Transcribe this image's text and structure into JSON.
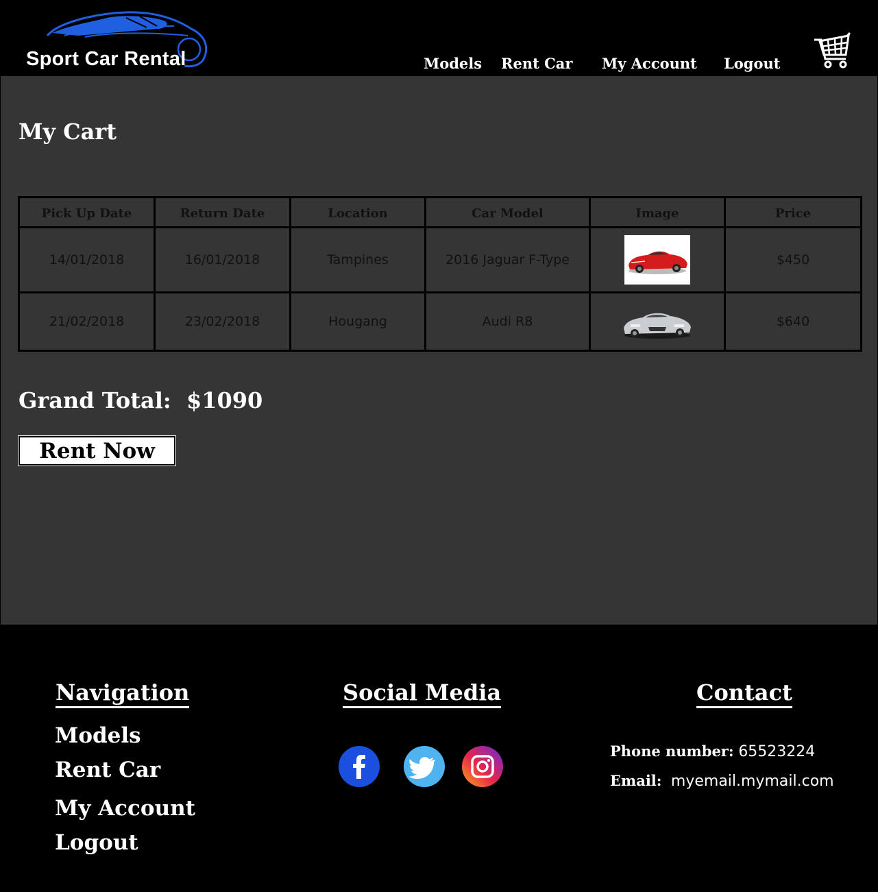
{
  "brand": {
    "name": "Sport Car Rental",
    "accent": "#1f5fe0"
  },
  "nav": [
    {
      "label": "Models"
    },
    {
      "label": "Rent Car"
    },
    {
      "label": "My Account"
    },
    {
      "label": "Logout"
    }
  ],
  "cart_icon": "shopping-cart-icon",
  "page_title": "My Cart",
  "table": {
    "headers": [
      "Pick Up Date",
      "Return Date",
      "Location",
      "Car Model",
      "Image",
      "Price"
    ],
    "rows": [
      {
        "pickup": "14/01/2018",
        "return": "16/01/2018",
        "location": "Tampines",
        "model": "2016 Jaguar F-Type",
        "image": "red-sports-car",
        "price": "$450"
      },
      {
        "pickup": "21/02/2018",
        "return": "23/02/2018",
        "location": "Hougang",
        "model": "Audi R8",
        "image": "silver-sports-car",
        "price": "$640"
      }
    ]
  },
  "grand_total": {
    "label": "Grand Total:",
    "value": "$1090"
  },
  "rent_button": "Rent Now",
  "footer": {
    "navigation": {
      "heading": "Navigation",
      "links": [
        "Models",
        "Rent Car",
        "My Account",
        "Logout"
      ]
    },
    "social": {
      "heading": "Social Media",
      "icons": [
        "facebook-icon",
        "twitter-icon",
        "instagram-icon"
      ]
    },
    "contact": {
      "heading": "Contact",
      "phone_label": "Phone number:",
      "phone": "65523224",
      "email_label": "Email:",
      "email": "myemail.mymail.com"
    }
  },
  "colors": {
    "header_bg": "#000000",
    "main_bg": "#353535",
    "facebook": "#1a4fe0",
    "twitter": "#4fb3f0"
  }
}
